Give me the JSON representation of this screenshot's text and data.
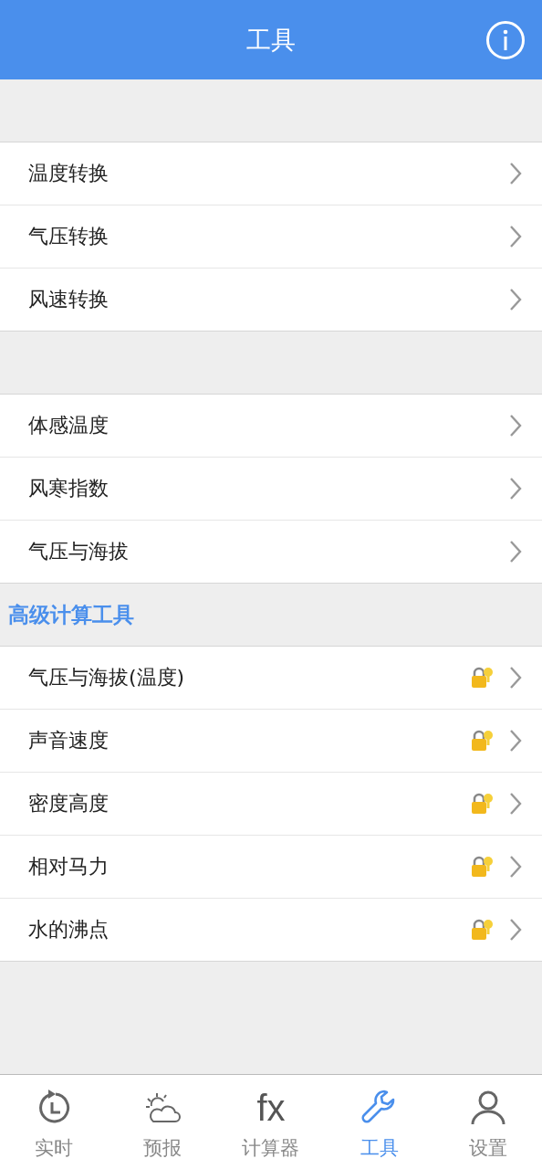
{
  "header": {
    "title": "工具"
  },
  "sections": [
    {
      "items": [
        {
          "label": "温度转换",
          "locked": false
        },
        {
          "label": "气压转换",
          "locked": false
        },
        {
          "label": "风速转换",
          "locked": false
        }
      ]
    },
    {
      "items": [
        {
          "label": "体感温度",
          "locked": false
        },
        {
          "label": "风寒指数",
          "locked": false
        },
        {
          "label": "气压与海拔",
          "locked": false
        }
      ]
    },
    {
      "title": "高级计算工具",
      "items": [
        {
          "label": "气压与海拔(温度)",
          "locked": true
        },
        {
          "label": "声音速度",
          "locked": true
        },
        {
          "label": "密度高度",
          "locked": true
        },
        {
          "label": "相对马力",
          "locked": true
        },
        {
          "label": "水的沸点",
          "locked": true
        }
      ]
    }
  ],
  "tabs": [
    {
      "kind": "clock",
      "label": "实时",
      "selected": false
    },
    {
      "kind": "weather",
      "label": "预报",
      "selected": false
    },
    {
      "kind": "formula",
      "glyph": "fx",
      "label": "计算器",
      "selected": false
    },
    {
      "kind": "wrench",
      "label": "工具",
      "selected": true
    },
    {
      "kind": "person",
      "label": "设置",
      "selected": false
    }
  ]
}
